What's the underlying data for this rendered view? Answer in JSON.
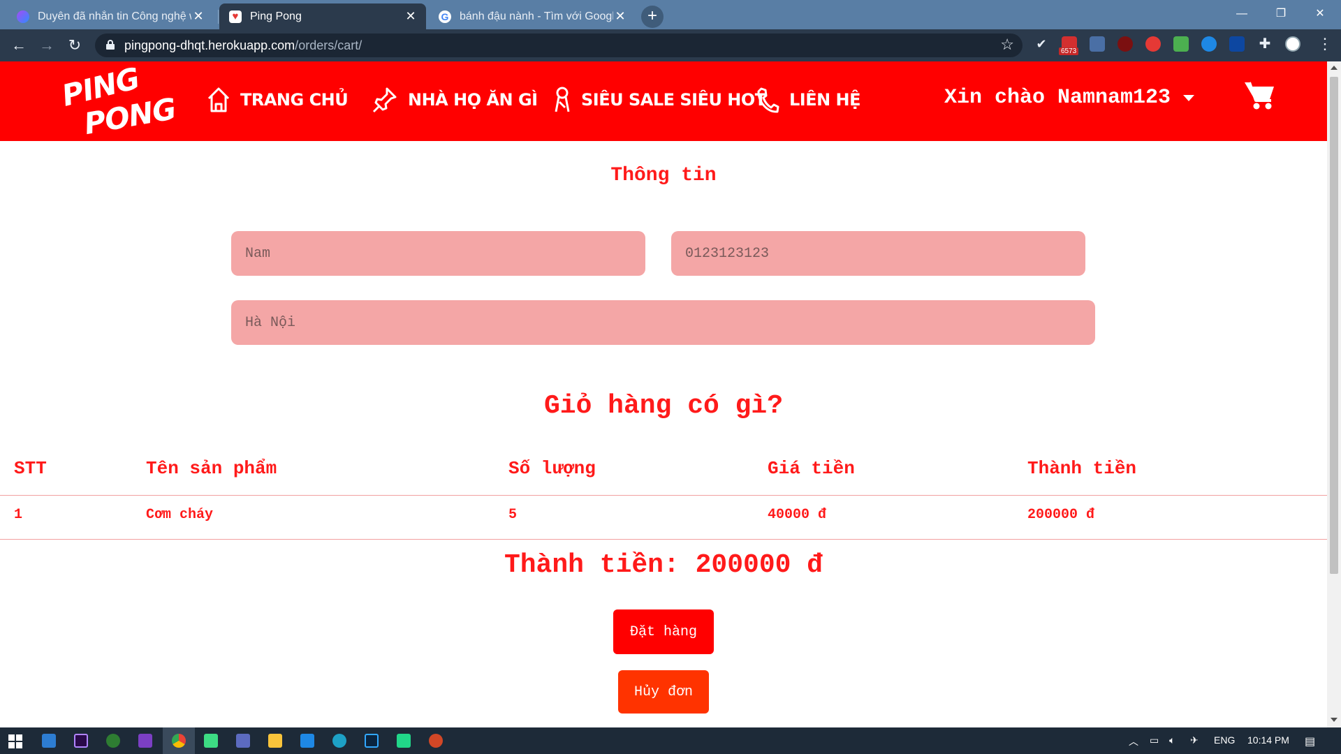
{
  "browser": {
    "tabs": [
      {
        "title": "Duyên đã nhắn tin Công nghệ w",
        "active": false
      },
      {
        "title": "Ping Pong",
        "active": true
      },
      {
        "title": "bánh đậu nành - Tìm với Google",
        "active": false
      }
    ],
    "new_tab": "+",
    "url_host": "pingpong-dhqt.herokuapp.com",
    "url_path": "/orders/cart/",
    "badge_count": "6573"
  },
  "site": {
    "logo_line1": "PING",
    "logo_line2": "PONG",
    "nav": [
      {
        "label": "TRANG CHỦ",
        "icon": "house-icon"
      },
      {
        "label": "NHÀ HỌ ĂN GÌ",
        "icon": "pushpin-icon"
      },
      {
        "label": "SIÊU SALE SIÊU HOT",
        "icon": "ribbon-icon"
      },
      {
        "label": "LIÊN HỆ",
        "icon": "phone-icon"
      }
    ],
    "greeting": "Xin chào Namnam123",
    "brand_color": "#ff0000"
  },
  "info": {
    "title": "Thông tin",
    "name_value": "Nam",
    "phone_value": "0123123123",
    "address_value": "Hà Nội"
  },
  "cart": {
    "title": "Giỏ hàng có gì?",
    "columns": [
      "STT",
      "Tên sản phẩm",
      "Số lượng",
      "Giá tiền",
      "Thành tiền"
    ],
    "rows": [
      [
        "1",
        "Cơm cháy",
        "5",
        "40000 đ",
        "200000 đ"
      ]
    ],
    "total_label": "Thành tiền: 200000 đ",
    "order_button": "Đặt hàng",
    "cancel_button": "Hủy đơn"
  },
  "taskbar": {
    "language": "ENG",
    "time": "10:14 PM"
  }
}
